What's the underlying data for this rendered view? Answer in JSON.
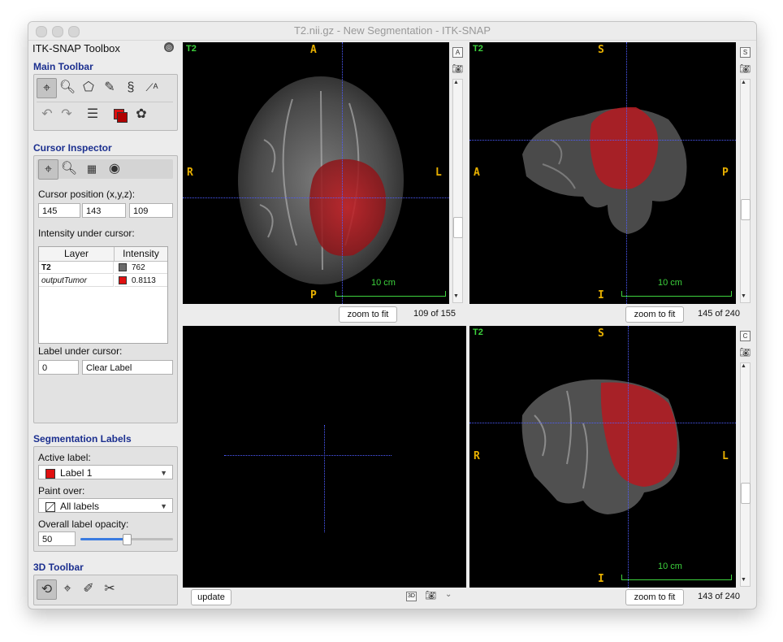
{
  "window": {
    "title": "T2.nii.gz - New Segmentation - ITK-SNAP"
  },
  "toolbox": {
    "title": "ITK-SNAP Toolbox",
    "main_toolbar": {
      "title": "Main Toolbar",
      "tools_row1": [
        "crosshair-tool",
        "zoom-tool",
        "polygon-tool",
        "paintbrush-tool",
        "snake-tool",
        "annotation-tool"
      ],
      "tools_row2": [
        "undo",
        "redo",
        "layers",
        "label-colors",
        "palette"
      ]
    },
    "cursor_inspector": {
      "title": "Cursor Inspector",
      "position_label": "Cursor position (x,y,z):",
      "x": "145",
      "y": "143",
      "z": "109",
      "intensity_label": "Intensity under cursor:",
      "columns": [
        "Layer",
        "Intensity"
      ],
      "rows": [
        {
          "layer": "T2",
          "value": "762",
          "color": "#6b6b6b"
        },
        {
          "layer": "outputTumor",
          "value": "0.8113",
          "color": "#e01010"
        }
      ],
      "label_under_cursor": "Label under cursor:",
      "label_id": "0",
      "label_name": "Clear Label"
    },
    "segmentation_labels": {
      "title": "Segmentation Labels",
      "active_label_caption": "Active label:",
      "active_label": "Label 1",
      "active_label_color": "#e01010",
      "paint_over_caption": "Paint over:",
      "paint_over": "All labels",
      "opacity_caption": "Overall label opacity:",
      "opacity": "50",
      "opacity_fraction": 0.5
    },
    "toolbar_3d": {
      "title": "3D Toolbar"
    }
  },
  "views": {
    "axial": {
      "layer": "T2",
      "top": "A",
      "bottom": "P",
      "left": "R",
      "right": "L",
      "scale": "10 cm",
      "zoom_button": "zoom to fit",
      "slice": "109 of 155",
      "side_button": "A"
    },
    "sagittal": {
      "layer": "T2",
      "top": "S",
      "bottom": "I",
      "left": "A",
      "right": "P",
      "scale": "10 cm",
      "zoom_button": "zoom to fit",
      "slice": "145 of 240",
      "side_button": "S"
    },
    "three_d": {
      "update_button": "update"
    },
    "coronal": {
      "layer": "T2",
      "top": "S",
      "bottom": "I",
      "left": "R",
      "right": "L",
      "scale": "10 cm",
      "zoom_button": "zoom to fit",
      "slice": "143 of 240",
      "side_button": "C"
    }
  },
  "colors": {
    "section_title": "#1b2f8f",
    "orientation_label": "#e8b000",
    "scale_bar": "#3dd23d",
    "crosshair": "#4e5cff",
    "tumor": "#c0141e"
  }
}
